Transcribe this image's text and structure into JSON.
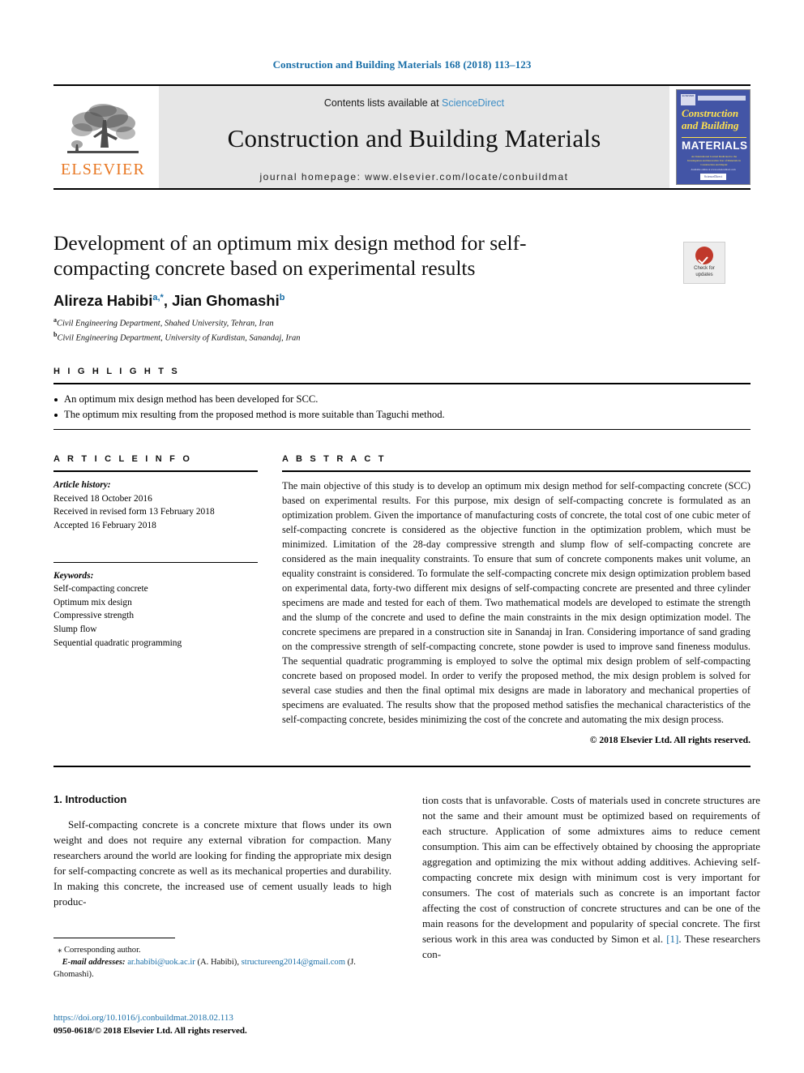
{
  "running_head": "Construction and Building Materials 168 (2018) 113–123",
  "masthead": {
    "publisher_logo_label": "ELSEVIER",
    "contents_prefix": "Contents lists available at ",
    "contents_link": "ScienceDirect",
    "journal_title": "Construction and Building Materials",
    "homepage_line": "journal homepage: www.elsevier.com/locate/conbuildmat",
    "cover": {
      "line1": "Construction",
      "line2": "and Building",
      "line3": "MATERIALS",
      "subtitle": "An International Journal Dedicated to the Investigation and Innovative Use of Materials in Construction and Repair",
      "footer": "Available online at www.sciencedirect.com",
      "footer_badge": "ScienceDirect",
      "logo_box": "ELSEVIER"
    }
  },
  "article": {
    "title": "Development of an optimum mix design method for self-compacting concrete based on experimental results",
    "authors_html": "Alireza Habibi, Jian Ghomashi",
    "author1_name": "Alireza Habibi",
    "author1_sup": "a,*",
    "author2_name": ", Jian Ghomashi",
    "author2_sup": "b",
    "affiliations": [
      {
        "sup": "a",
        "text": "Civil Engineering Department, Shahed University, Tehran, Iran"
      },
      {
        "sup": "b",
        "text": "Civil Engineering Department, University of Kurdistan, Sanandaj, Iran"
      }
    ],
    "crossmark": {
      "line1": "Check for",
      "line2": "updates"
    }
  },
  "highlights": {
    "heading": "H I G H L I G H T S",
    "items": [
      "An optimum mix design method has been developed for SCC.",
      "The optimum mix resulting from the proposed method is more suitable than Taguchi method."
    ]
  },
  "article_info": {
    "heading": "A R T I C L E   I N F O",
    "history_label": "Article history:",
    "history": [
      "Received 18 October 2016",
      "Received in revised form 13 February 2018",
      "Accepted 16 February 2018"
    ],
    "keywords_label": "Keywords:",
    "keywords": [
      "Self-compacting concrete",
      "Optimum mix design",
      "Compressive strength",
      "Slump flow",
      "Sequential quadratic programming"
    ]
  },
  "abstract": {
    "heading": "A B S T R A C T",
    "text": "The main objective of this study is to develop an optimum mix design method for self-compacting concrete (SCC) based on experimental results. For this purpose, mix design of self-compacting concrete is formulated as an optimization problem. Given the importance of manufacturing costs of concrete, the total cost of one cubic meter of self-compacting concrete is considered as the objective function in the optimization problem, which must be minimized. Limitation of the 28-day compressive strength and slump flow of self-compacting concrete are considered as the main inequality constraints. To ensure that sum of concrete components makes unit volume, an equality constraint is considered. To formulate the self-compacting concrete mix design optimization problem based on experimental data, forty-two different mix designs of self-compacting concrete are presented and three cylinder specimens are made and tested for each of them. Two mathematical models are developed to estimate the strength and the slump of the concrete and used to define the main constraints in the mix design optimization model. The concrete specimens are prepared in a construction site in Sanandaj in Iran. Considering importance of sand grading on the compressive strength of self-compacting concrete, stone powder is used to improve sand fineness modulus. The sequential quadratic programming is employed to solve the optimal mix design problem of self-compacting concrete based on proposed model. In order to verify the proposed method, the mix design problem is solved for several case studies and then the final optimal mix designs are made in laboratory and mechanical properties of specimens are evaluated. The results show that the proposed method satisfies the mechanical characteristics of the self-compacting concrete, besides minimizing the cost of the concrete and automating the mix design process.",
    "copyright": "© 2018 Elsevier Ltd. All rights reserved."
  },
  "body": {
    "section_heading": "1. Introduction",
    "col_left": "Self-compacting concrete is a concrete mixture that flows under its own weight and does not require any external vibration for compaction. Many researchers around the world are looking for finding the appropriate mix design for self-compacting concrete as well as its mechanical properties and durability. In making this concrete, the increased use of cement usually leads to high produc-",
    "col_right_pre": "tion costs that is unfavorable. Costs of materials used in concrete structures are not the same and their amount must be optimized based on requirements of each structure. Application of some admixtures aims to reduce cement consumption. This aim can be effectively obtained by choosing the appropriate aggregation and optimizing the mix without adding additives. Achieving self-compacting concrete mix design with minimum cost is very important for consumers. The cost of materials such as concrete is an important factor affecting the cost of construction of concrete structures and can be one of the main reasons for the development and popularity of special concrete. The first serious work in this area was conducted by Simon et al. ",
    "col_right_cite": "[1]",
    "col_right_post": ". These researchers con-"
  },
  "footnotes": {
    "corresponding_star": "⁎",
    "corresponding_label": "Corresponding author.",
    "email_label": "E-mail addresses:",
    "email1": "ar.habibi@uok.ac.ir",
    "email1_owner": "(A. Habibi),",
    "email2": "structureeng2014@gmail.com",
    "email2_owner": "(J. Ghomashi)."
  },
  "imprint": {
    "doi": "https://doi.org/10.1016/j.conbuildmat.2018.02.113",
    "issn_line": "0950-0618/© 2018 Elsevier Ltd. All rights reserved."
  },
  "colors": {
    "link_blue": "#1a6fa8",
    "sciencedirect_blue": "#3c8dc5",
    "elsevier_orange": "#e87722",
    "cover_blue": "#4355a6",
    "band_gray": "#e6e6e6"
  }
}
